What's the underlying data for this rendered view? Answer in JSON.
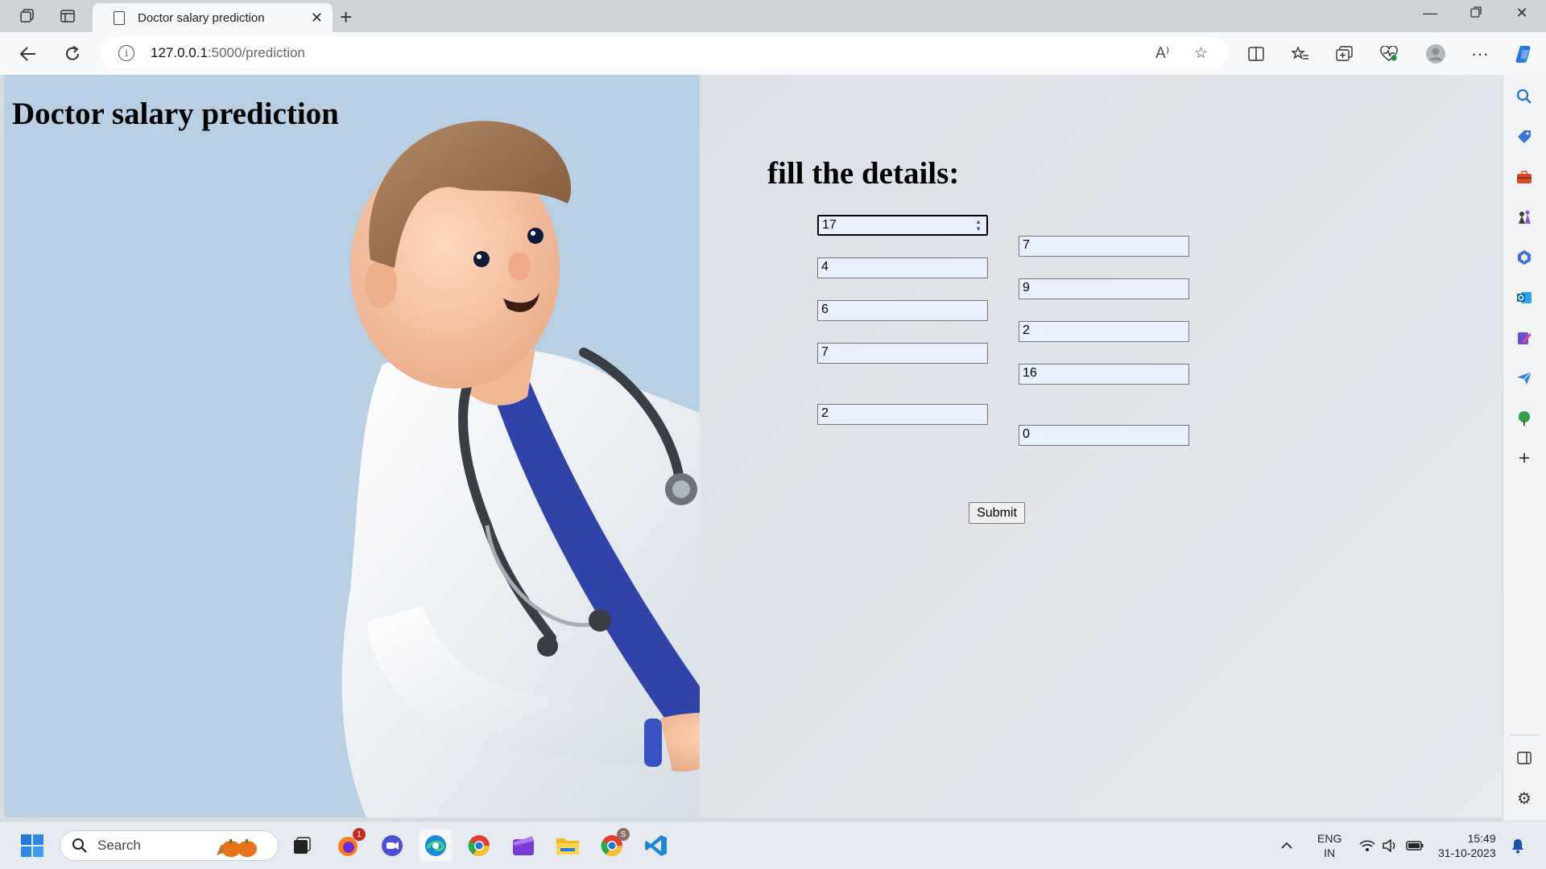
{
  "browser": {
    "tab_title": "Doctor salary prediction",
    "url_host": "127.0.0.1",
    "url_path": ":5000/prediction",
    "read_aloud_label": "A⁾"
  },
  "page": {
    "title": "Doctor salary prediction",
    "form_heading": "fill the details:",
    "fields_left": [
      "17",
      "4",
      "6",
      "7",
      "2"
    ],
    "fields_right": [
      "7",
      "9",
      "2",
      "16",
      "0"
    ],
    "submit_label": "Submit"
  },
  "taskbar": {
    "search_placeholder": "Search",
    "notification_count": "1",
    "chrome_profile_letter": "S",
    "language_line1": "ENG",
    "language_line2": "IN",
    "time": "15:49",
    "date": "31-10-2023"
  }
}
